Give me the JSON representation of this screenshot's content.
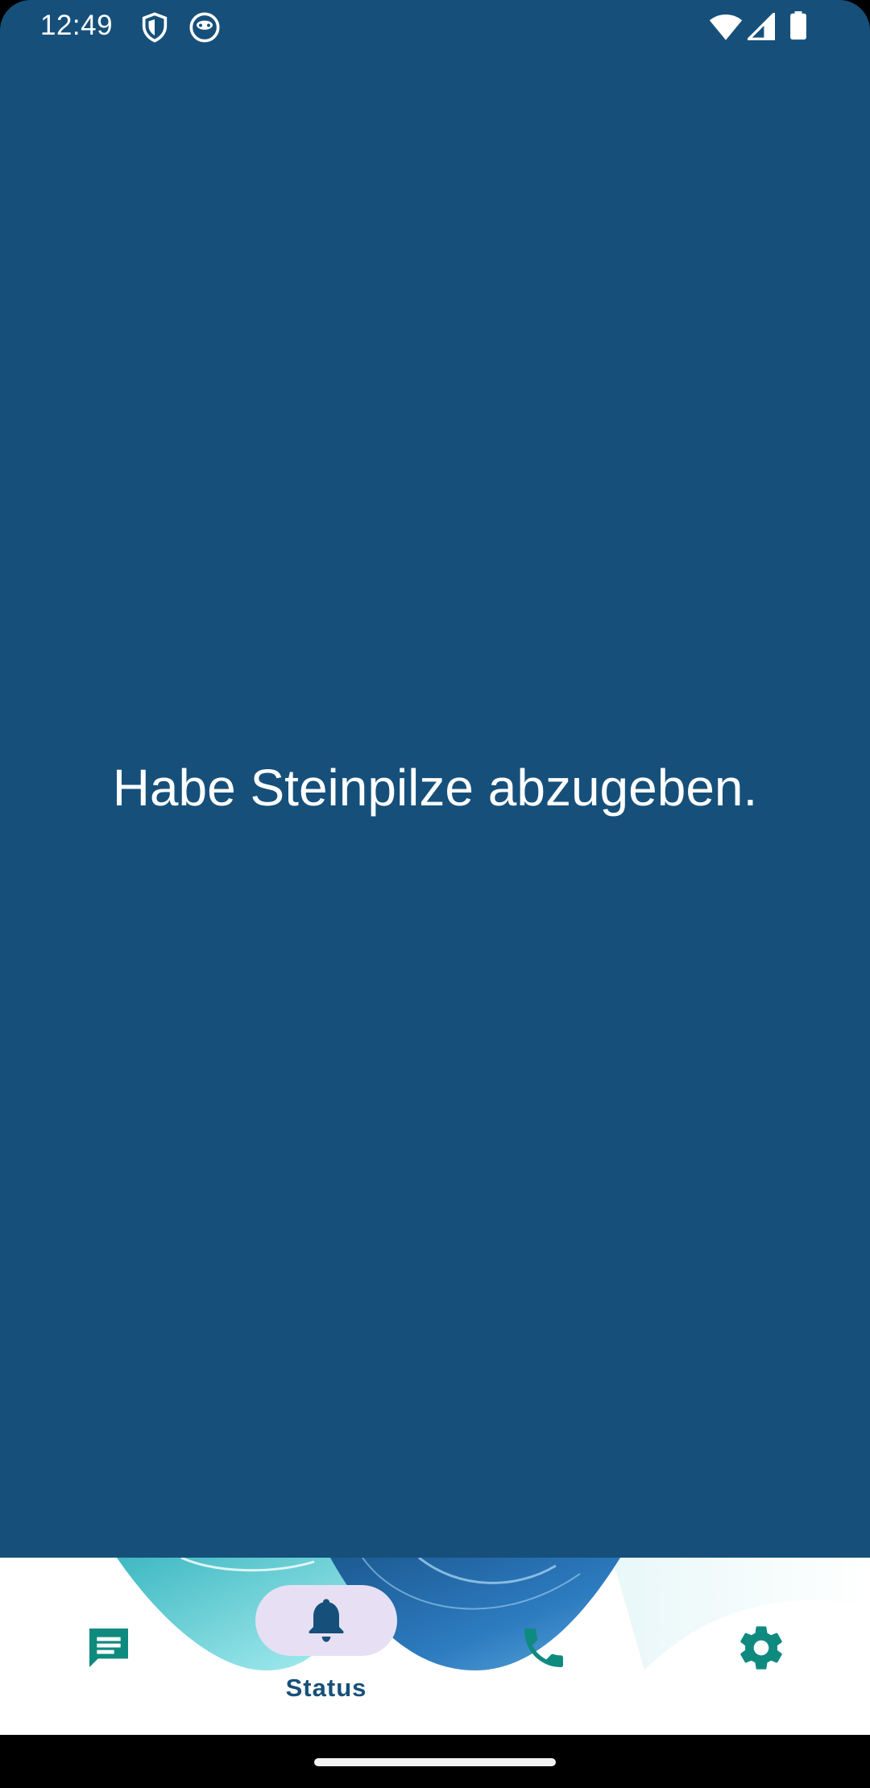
{
  "status_bar": {
    "time": "12:49",
    "icons": [
      "shield-icon",
      "face-icon",
      "wifi-icon",
      "cell-signal-icon",
      "battery-icon"
    ]
  },
  "main": {
    "message": "Habe Steinpilze abzugeben."
  },
  "bottom_nav": {
    "items": [
      {
        "name": "messages",
        "icon": "message-icon",
        "label": ""
      },
      {
        "name": "status",
        "icon": "bell-icon",
        "label": "Status",
        "selected": true
      },
      {
        "name": "calls",
        "icon": "phone-icon",
        "label": ""
      },
      {
        "name": "settings",
        "icon": "gear-icon",
        "label": ""
      }
    ]
  },
  "colors": {
    "background": "#16507a",
    "accent": "#0f8a7f",
    "selected_pill": "#e7e0f5",
    "nav_label": "#16507a"
  }
}
